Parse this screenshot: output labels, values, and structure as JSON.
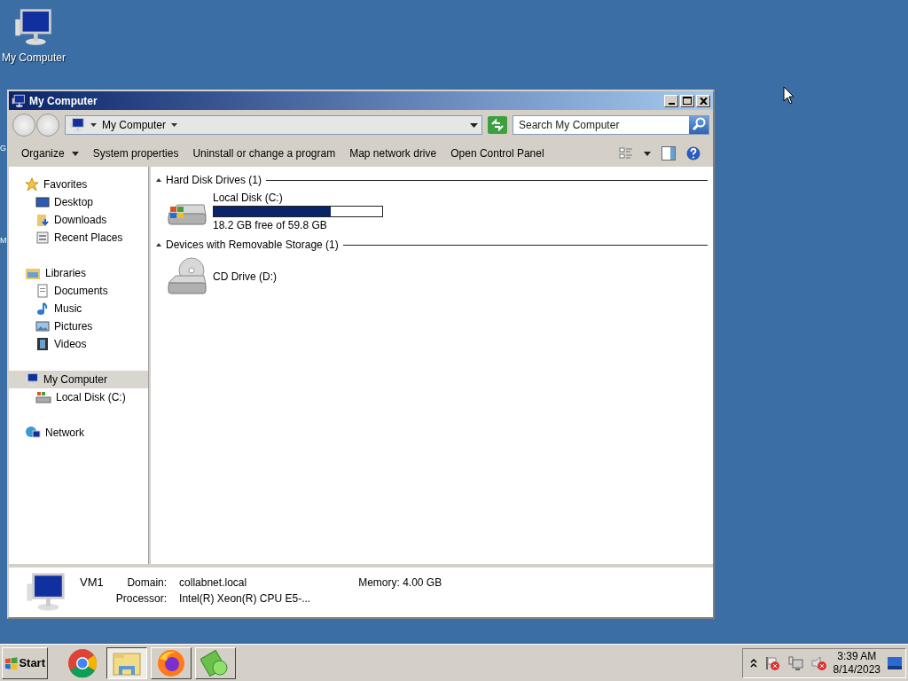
{
  "desktop": {
    "icons": [
      {
        "label": "My Computer",
        "kind": "computer"
      }
    ],
    "partial_labels": [
      "G",
      "M"
    ]
  },
  "window": {
    "title": "My Computer",
    "active": true
  },
  "address_bar": {
    "path": "My Computer",
    "search": {
      "placeholder": "Search My Computer"
    }
  },
  "toolbar": {
    "commands": [
      {
        "label": "Organize",
        "kind": "menu"
      },
      {
        "label": "System properties",
        "kind": "command"
      },
      {
        "label": "Uninstall or change a program",
        "kind": "command"
      },
      {
        "label": "Map network drive",
        "kind": "command"
      },
      {
        "label": "Open Control Panel",
        "kind": "command"
      }
    ]
  },
  "sidebar": {
    "items": [
      {
        "label": "Favorites",
        "kind": "star",
        "selected": false,
        "children": [
          {
            "label": "Desktop",
            "kind": "desktop",
            "selected": false
          },
          {
            "label": "Downloads",
            "kind": "downloads",
            "selected": false
          },
          {
            "label": "Recent Places",
            "kind": "recent",
            "selected": false
          }
        ]
      },
      {
        "label": "Libraries",
        "kind": "library",
        "selected": false,
        "children": [
          {
            "label": "Documents",
            "kind": "document",
            "selected": false
          },
          {
            "label": "Music",
            "kind": "music",
            "selected": false
          },
          {
            "label": "Pictures",
            "kind": "pictures",
            "selected": false
          },
          {
            "label": "Videos",
            "kind": "videos",
            "selected": false
          }
        ]
      },
      {
        "label": "My Computer",
        "kind": "computer",
        "selected": true,
        "children": [
          {
            "label": "Local Disk (C:)",
            "kind": "drive",
            "selected": false
          }
        ]
      },
      {
        "label": "Network",
        "kind": "network",
        "selected": false
      }
    ]
  },
  "content": {
    "groups": [
      {
        "title": "Hard Disk Drives (1)",
        "expanded": true,
        "items": [
          {
            "name": "Local Disk (C:)",
            "kind": "hdd",
            "level": 0.696,
            "caption": "18.2 GB free of 59.8 GB"
          }
        ]
      },
      {
        "title": "Devices with Removable Storage (1)",
        "expanded": true,
        "items": [
          {
            "name": "CD Drive (D:)",
            "kind": "cd"
          }
        ]
      }
    ]
  },
  "details": {
    "name": "VM1",
    "fields": [
      {
        "label": "Domain:",
        "value": "collabnet.local"
      },
      {
        "label": "Memory:",
        "value": "4.00 GB"
      },
      {
        "label": "Processor:",
        "value": "Intel(R) Xeon(R) CPU E5-..."
      }
    ]
  },
  "taskbar": {
    "start": "Start",
    "apps": [
      {
        "kind": "chrome",
        "selected": false
      },
      {
        "kind": "explorer",
        "selected": true
      },
      {
        "kind": "firefox",
        "selected": false
      },
      {
        "kind": "green",
        "selected": false
      }
    ],
    "tray": {
      "icons": [
        {
          "kind": "flag"
        },
        {
          "kind": "network"
        },
        {
          "kind": "speaker"
        }
      ],
      "time": "3:39 AM",
      "date": "8/14/2023"
    }
  }
}
